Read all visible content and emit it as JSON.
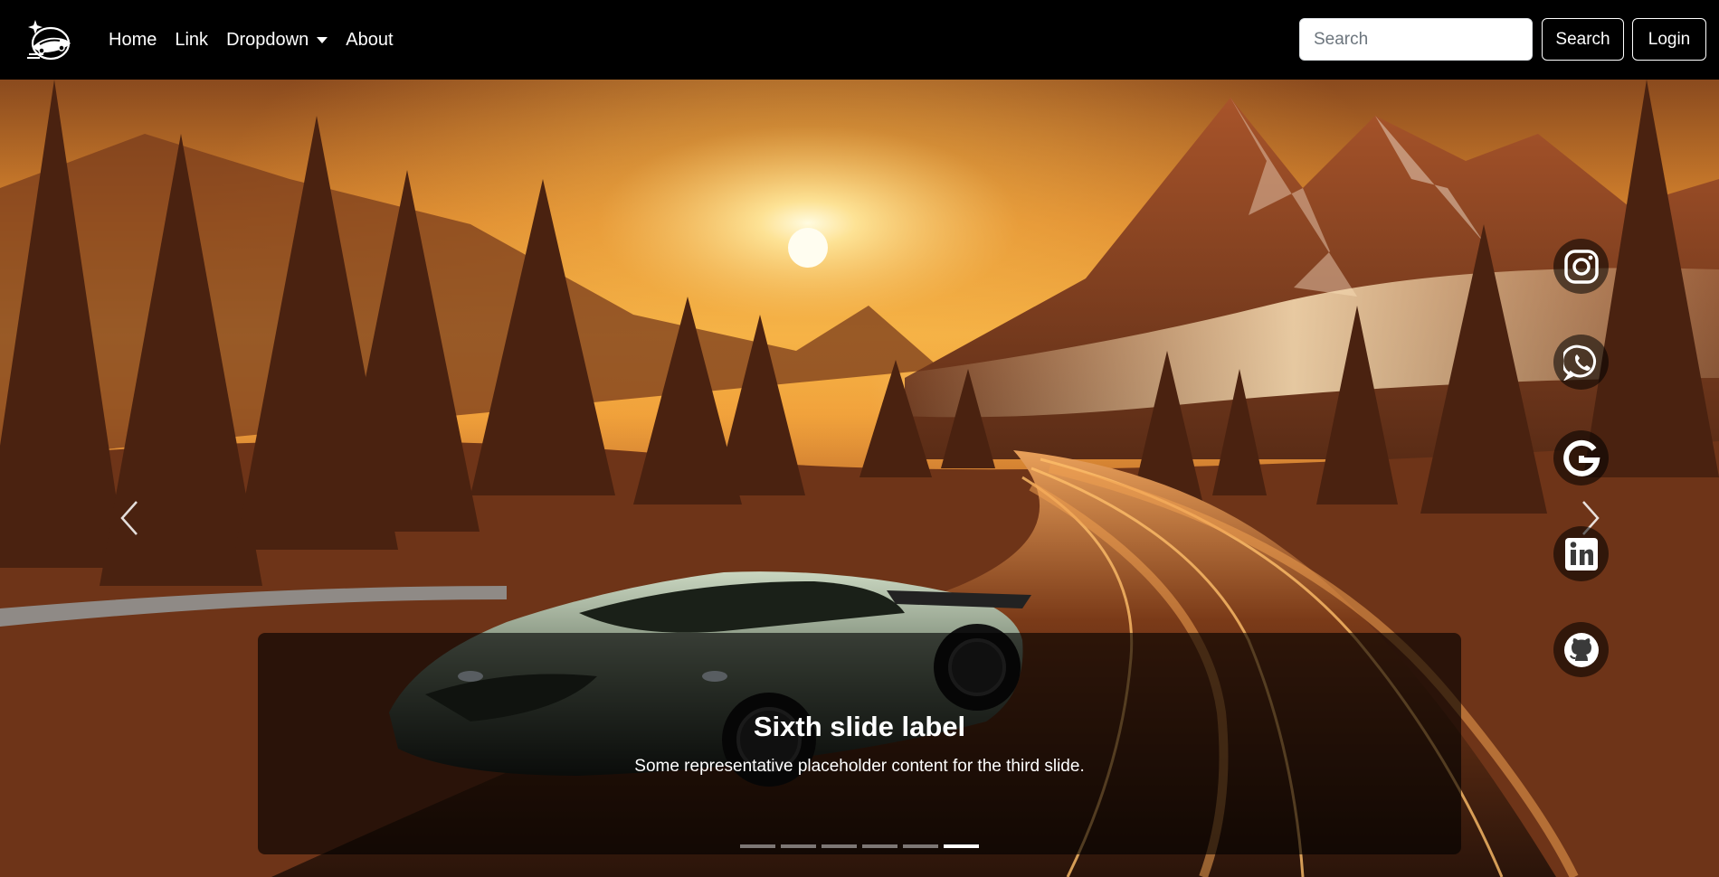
{
  "navbar": {
    "links": [
      {
        "label": "Home"
      },
      {
        "label": "Link"
      },
      {
        "label": "Dropdown"
      },
      {
        "label": "About"
      }
    ],
    "search_placeholder": "Search",
    "search_button": "Search",
    "login_button": "Login"
  },
  "carousel": {
    "caption_title": "Sixth slide label",
    "caption_text": "Some representative placeholder content for the third slide.",
    "slide_count": 6,
    "active_slide": 6
  },
  "social": [
    {
      "icon": "instagram-icon"
    },
    {
      "icon": "whatsapp-icon"
    },
    {
      "icon": "google-icon"
    },
    {
      "icon": "linkedin-icon"
    },
    {
      "icon": "github-icon"
    }
  ],
  "colors": {
    "navbar_bg": "#000000",
    "sky_top": "#f3a23a",
    "sun": "#fff6c8"
  }
}
